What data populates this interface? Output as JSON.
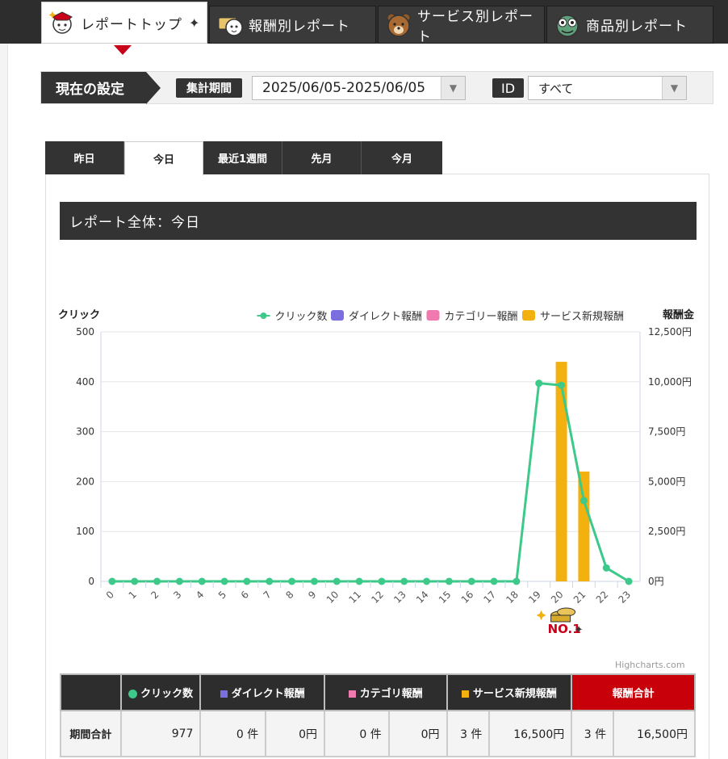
{
  "tabs": [
    {
      "label": "レポートトップ",
      "icon": "mascot-samurai-icon",
      "active": true
    },
    {
      "label": "報酬別レポート",
      "icon": "mascot-money-icon",
      "active": false
    },
    {
      "label": "サービス別レポート",
      "icon": "mascot-bear-icon",
      "active": false
    },
    {
      "label": "商品別レポート",
      "icon": "mascot-frog-icon",
      "active": false
    }
  ],
  "settings": {
    "label": "現在の設定",
    "period_label": "集計期間",
    "period_value": "2025/06/05-2025/06/05",
    "id_label": "ID",
    "id_value": "すべて"
  },
  "period_tabs": [
    "昨日",
    "今日",
    "最近1週間",
    "先月",
    "今月"
  ],
  "active_period": "今日",
  "report_title": "レポート全体：今日",
  "chart_data": {
    "type": "line",
    "x": [
      "0",
      "1",
      "2",
      "3",
      "4",
      "5",
      "6",
      "7",
      "8",
      "9",
      "10",
      "11",
      "12",
      "13",
      "14",
      "15",
      "16",
      "17",
      "18",
      "19",
      "20",
      "21",
      "22",
      "23"
    ],
    "ylabel_left": "クリック",
    "ylabel_right": "報酬金",
    "ylim_left": [
      0,
      500
    ],
    "ylim_right": [
      0,
      12500
    ],
    "yticks_left": [
      "500",
      "400",
      "300",
      "200",
      "100",
      "0"
    ],
    "yticks_right": [
      "12,500円",
      "10,000円",
      "7,500円",
      "5,000円",
      "2,500円",
      "0円"
    ],
    "legend_position": "top-right",
    "series": [
      {
        "name": "クリック数",
        "type": "line",
        "axis": "left",
        "color": "#3cc98a",
        "values": [
          0,
          0,
          0,
          0,
          0,
          0,
          0,
          0,
          0,
          0,
          0,
          0,
          0,
          0,
          0,
          0,
          0,
          0,
          0,
          397,
          393,
          162,
          27,
          0
        ]
      },
      {
        "name": "ダイレクト報酬",
        "type": "bar",
        "axis": "right",
        "color": "#7b6fe0",
        "values": [
          0,
          0,
          0,
          0,
          0,
          0,
          0,
          0,
          0,
          0,
          0,
          0,
          0,
          0,
          0,
          0,
          0,
          0,
          0,
          0,
          0,
          0,
          0,
          0
        ]
      },
      {
        "name": "カテゴリー報酬",
        "type": "bar",
        "axis": "right",
        "color": "#f07ab0",
        "values": [
          0,
          0,
          0,
          0,
          0,
          0,
          0,
          0,
          0,
          0,
          0,
          0,
          0,
          0,
          0,
          0,
          0,
          0,
          0,
          0,
          0,
          0,
          0,
          0
        ]
      },
      {
        "name": "サービス新規報酬",
        "type": "bar",
        "axis": "right",
        "color": "#f2b10f",
        "values": [
          0,
          0,
          0,
          0,
          0,
          0,
          0,
          0,
          0,
          0,
          0,
          0,
          0,
          0,
          0,
          0,
          0,
          0,
          0,
          0,
          11000,
          5500,
          0,
          0
        ]
      }
    ],
    "annotation": "NO.1",
    "grid": true
  },
  "credit": "Highcharts.com",
  "table": {
    "headers": [
      "",
      "クリック数",
      "ダイレクト報酬",
      "カテゴリ報酬",
      "サービス新規報酬",
      "報酬合計"
    ],
    "header_colors": {
      "click": "#3cc98a",
      "direct": "#7b6fe0",
      "category": "#f07ab0",
      "service": "#f2b10f"
    },
    "rows": [
      {
        "label": "期間合計",
        "clicks": "977",
        "direct_count": "0 件",
        "direct_amount": "0円",
        "cat_count": "0 件",
        "cat_amount": "0円",
        "svc_count": "3 件",
        "svc_amount": "16,500円",
        "total_count": "3 件",
        "total_amount": "16,500円"
      }
    ]
  }
}
